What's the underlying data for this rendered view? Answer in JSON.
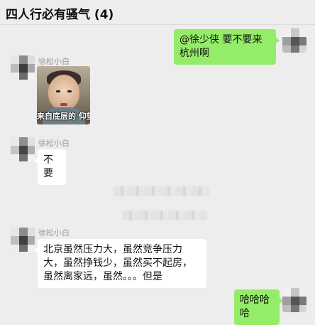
{
  "chat": {
    "title": "四人行必有骚气 (4)"
  },
  "messages": [
    {
      "side": "right",
      "text": "@徐少侠 要不要来杭州啊"
    },
    {
      "side": "left",
      "sender": "徐松小白",
      "sticker_caption": "来自底层的 仰望"
    },
    {
      "side": "left",
      "sender": "徐松小白",
      "text": "不要"
    },
    {
      "side": "left",
      "sender": "徐松小白",
      "text": "北京虽然压力大，虽然竞争压力大，虽然挣钱少，虽然买不起房，虽然离家远，虽然。。。但是"
    },
    {
      "side": "right",
      "text": "哈哈哈哈"
    }
  ],
  "colors": {
    "background": "#ededed",
    "bubble_self": "#95ec69",
    "bubble_other": "#ffffff"
  },
  "icons": [
    "avatar-mosaic"
  ]
}
